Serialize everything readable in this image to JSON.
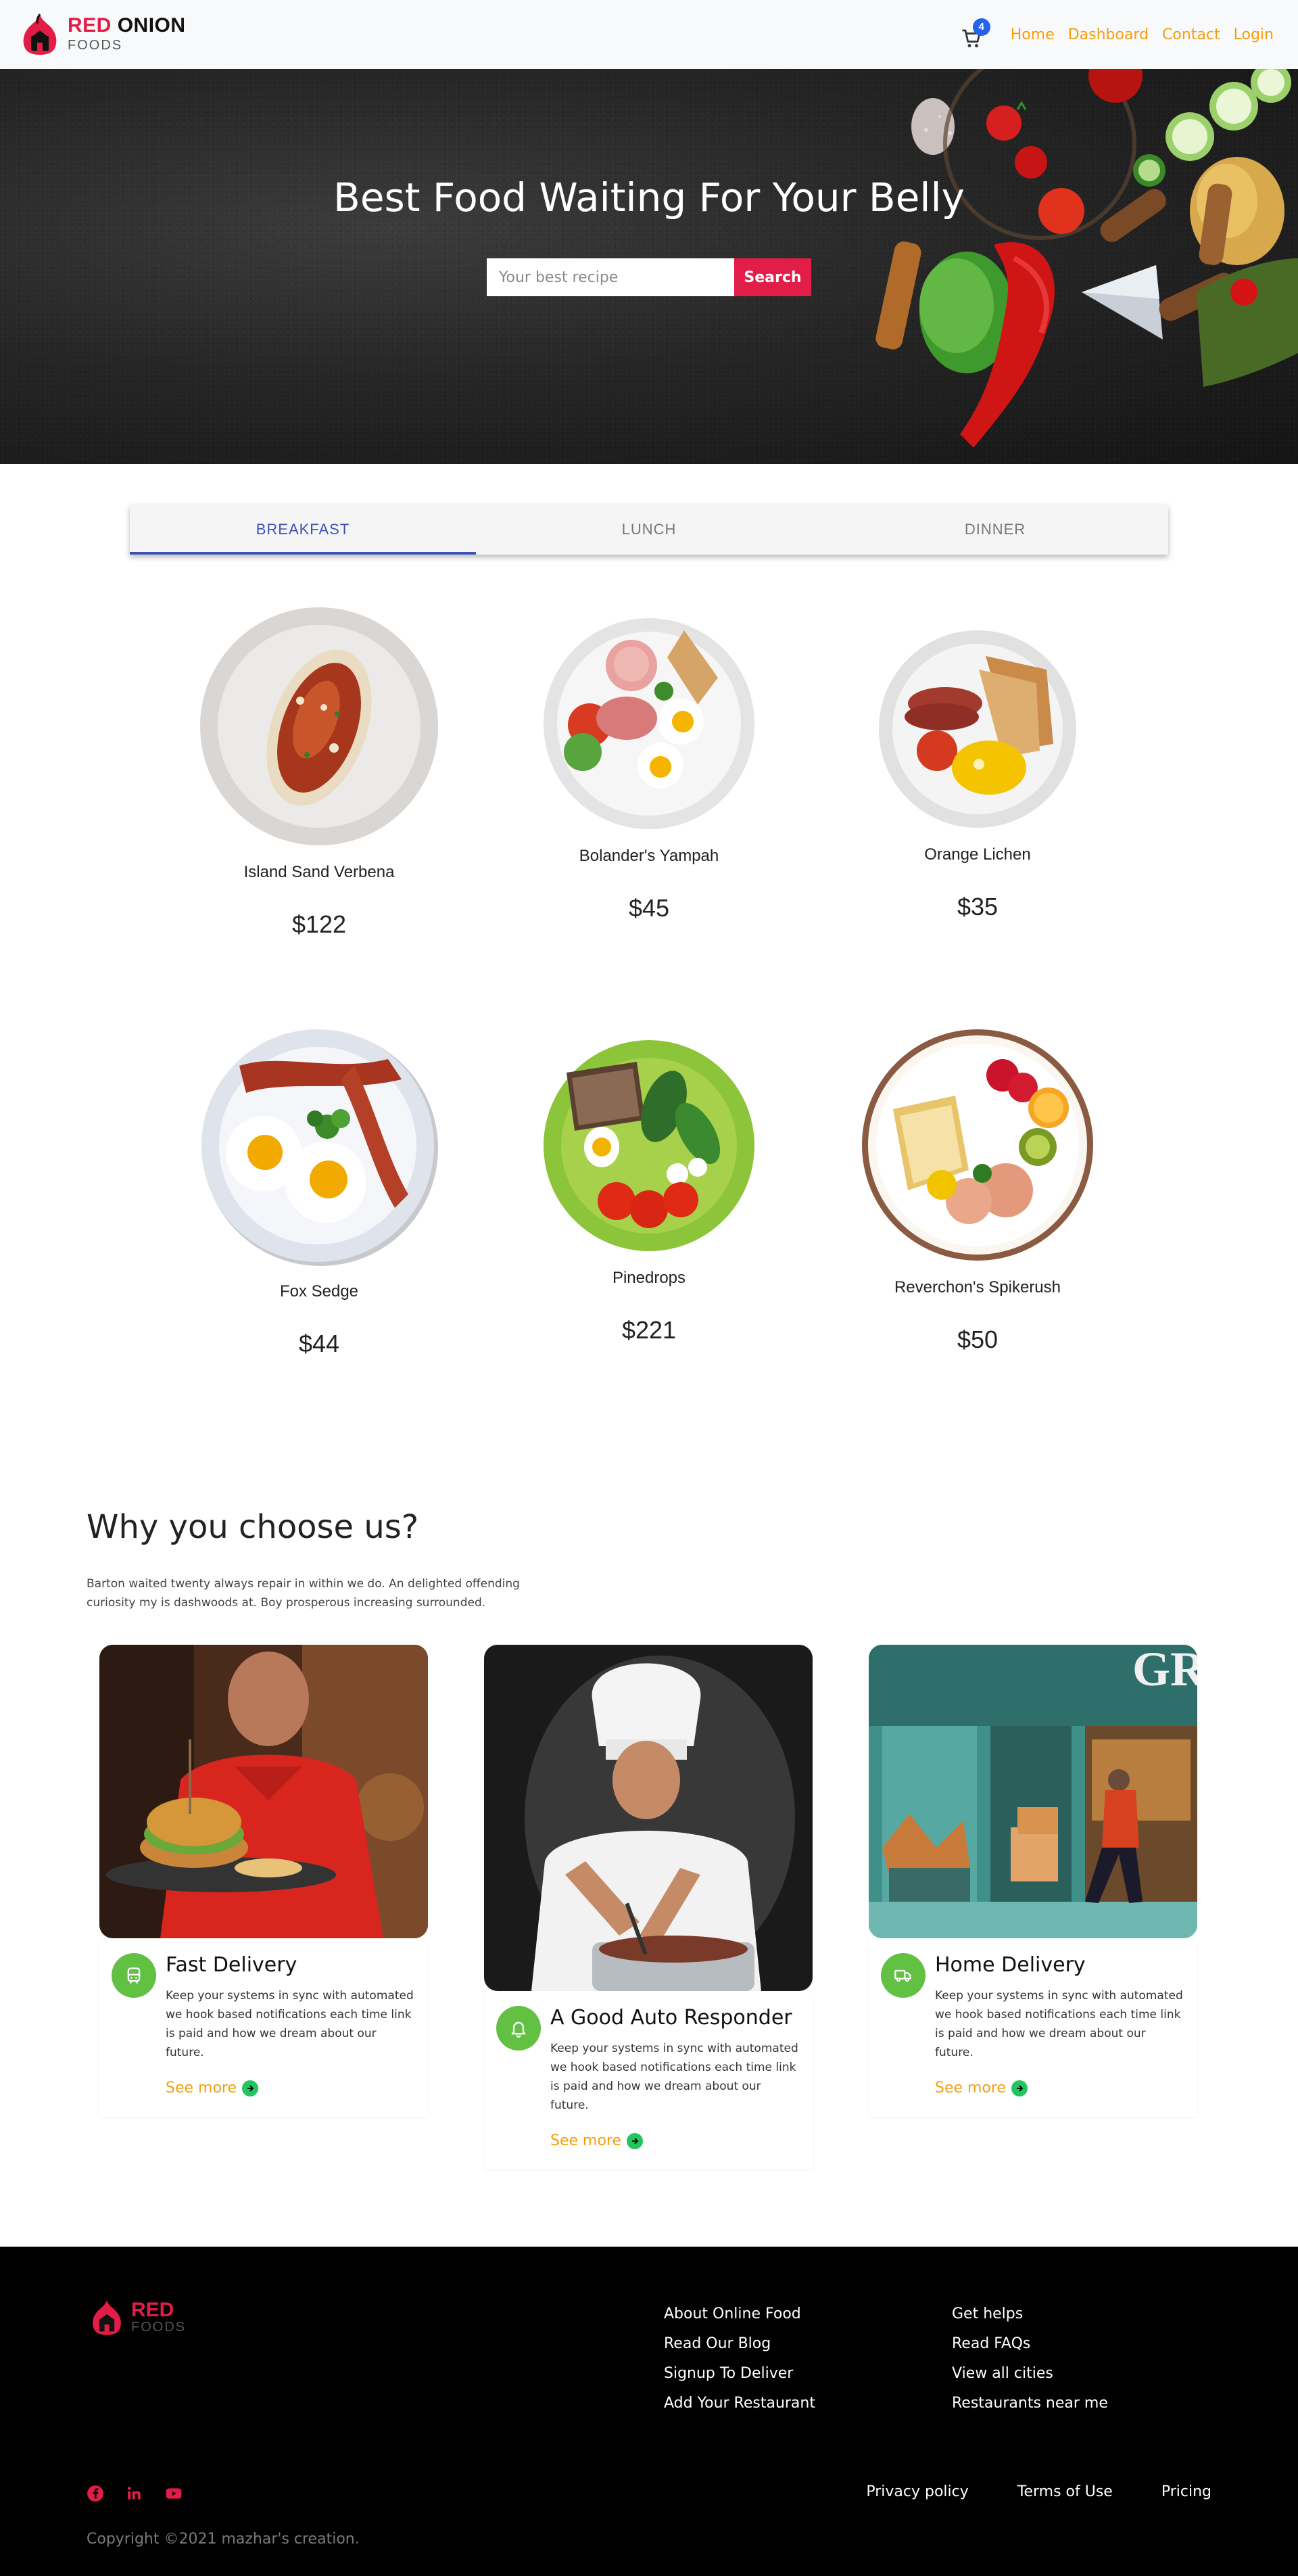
{
  "brand": {
    "name_red": "RED",
    "name_dark": "ONION",
    "subtitle": "FOODS"
  },
  "nav": {
    "cart_count": "4",
    "links": [
      "Home",
      "Dashboard",
      "Contact",
      "Login"
    ]
  },
  "hero": {
    "title": "Best Food Waiting For Your Belly",
    "search_placeholder": "Your best recipe",
    "search_button": "Search"
  },
  "tabs": [
    {
      "label": "BREAKFAST",
      "active": true
    },
    {
      "label": "LUNCH",
      "active": false
    },
    {
      "label": "DINNER",
      "active": false
    }
  ],
  "foods": [
    {
      "name": "Island Sand Verbena",
      "price": "$122"
    },
    {
      "name": "Bolander's Yampah",
      "price": "$45"
    },
    {
      "name": "Orange Lichen",
      "price": "$35"
    },
    {
      "name": "Fox Sedge",
      "price": "$44"
    },
    {
      "name": "Pinedrops",
      "price": "$221"
    },
    {
      "name": "Reverchon's Spikerush",
      "price": "$50"
    }
  ],
  "why": {
    "title": "Why you choose us?",
    "description": "Barton waited twenty always repair in within we do. An delighted offending curiosity my is dashwoods at. Boy prosperous increasing surrounded.",
    "features": [
      {
        "title": "Fast Delivery",
        "text": "Keep your systems in sync with automated we hook based notifications each time link is paid and how we dream about our future.",
        "more": "See more",
        "icon": "bus-icon"
      },
      {
        "title": "A Good Auto Responder",
        "text": "Keep your systems in sync with automated we hook based notifications each time link is paid and how we dream about our future.",
        "more": "See more",
        "icon": "bell-icon"
      },
      {
        "title": "Home Delivery",
        "text": "Keep your systems in sync with automated we hook based notifications each time link is paid and how we dream about our future.",
        "more": "See more",
        "icon": "truck-icon"
      }
    ]
  },
  "footer": {
    "brand_red": "RED",
    "brand_sub": "FOODS",
    "col1": [
      "About Online Food",
      "Read Our Blog",
      "Signup To Deliver",
      "Add Your Restaurant"
    ],
    "col2": [
      "Get helps",
      "Read FAQs",
      "View all cities",
      "Restaurants near me"
    ],
    "bottom_links": [
      "Privacy policy",
      "Terms of Use",
      "Pricing"
    ],
    "copyright": "Copyright ©2021 mazhar's creation.",
    "colors": {
      "accent": "#e11d48",
      "link": "#f59e0b",
      "green": "#62c043"
    }
  }
}
